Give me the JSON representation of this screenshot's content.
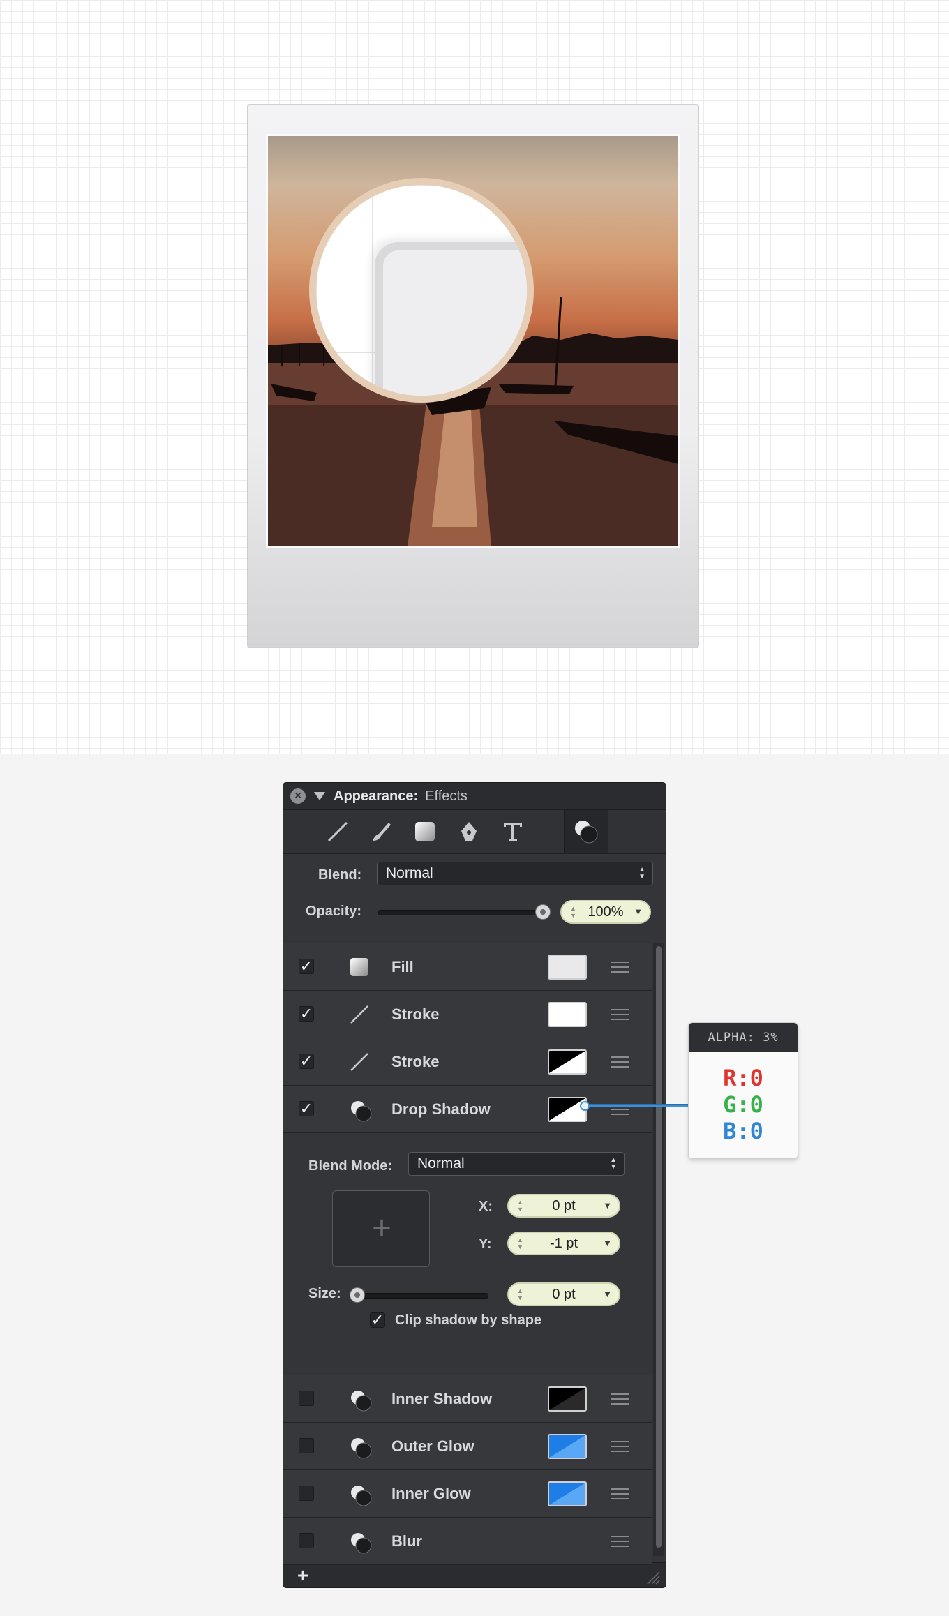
{
  "panel": {
    "title": "Appearance:",
    "subtitle": "Effects",
    "tools": [
      "stroke-tool-icon",
      "brush-tool-icon",
      "fill-tool-icon",
      "pen-tool-icon",
      "text-tool-icon",
      "effects-tool-icon"
    ],
    "blend_label": "Blend:",
    "blend_value": "Normal",
    "opacity_label": "Opacity:",
    "opacity_value": "100%",
    "opacity_fraction": 1.0,
    "effects": [
      {
        "name": "Fill",
        "checked": true,
        "icon": "fill-icon",
        "swatch": "light"
      },
      {
        "name": "Stroke",
        "checked": true,
        "icon": "stroke-icon",
        "swatch": "white"
      },
      {
        "name": "Stroke",
        "checked": true,
        "icon": "stroke-icon",
        "swatch": "diag-black-white"
      },
      {
        "name": "Drop Shadow",
        "checked": true,
        "icon": "shadow-icon",
        "swatch": "diag-black-white"
      }
    ],
    "shadow": {
      "blend_mode_label": "Blend Mode:",
      "blend_mode_value": "Normal",
      "x_label": "X:",
      "x_value": "0 pt",
      "y_label": "Y:",
      "y_value": "-1 pt",
      "size_label": "Size:",
      "size_value": "0 pt",
      "size_fraction": 0.0,
      "clip_label": "Clip shadow by shape",
      "clip_checked": true
    },
    "disabled_effects": [
      {
        "name": "Inner Shadow",
        "checked": false,
        "icon": "shadow-icon",
        "swatch": "diag-black"
      },
      {
        "name": "Outer Glow",
        "checked": false,
        "icon": "shadow-icon",
        "swatch": "diag-blue"
      },
      {
        "name": "Inner Glow",
        "checked": false,
        "icon": "shadow-icon",
        "swatch": "diag-blue"
      },
      {
        "name": "Blur",
        "checked": false,
        "icon": "shadow-icon",
        "swatch": "none"
      }
    ],
    "add_label": "+"
  },
  "callout": {
    "alpha": "ALPHA: 3%",
    "r": "R:0",
    "g": "G:0",
    "b": "B:0"
  },
  "colors": {
    "panel_bg": "#333539",
    "accent_blue": "#3f8fd6",
    "stepper_bg": "#eef2d6"
  }
}
